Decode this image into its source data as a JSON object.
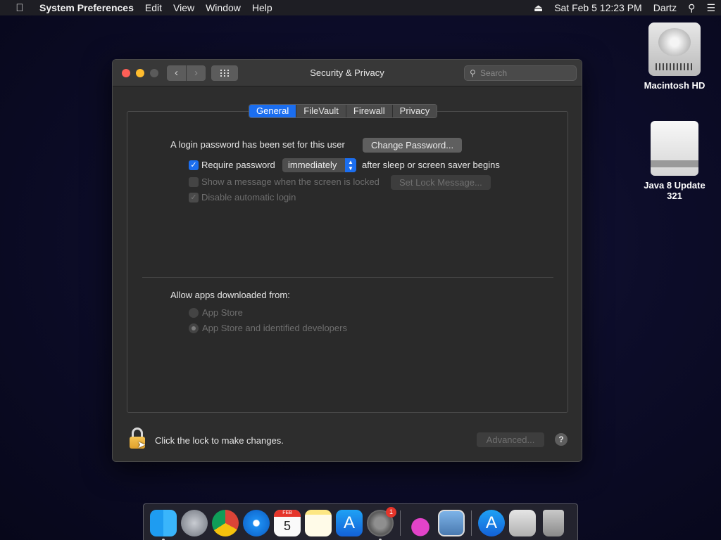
{
  "menubar": {
    "app_name": "System Preferences",
    "menus": [
      "Edit",
      "View",
      "Window",
      "Help"
    ],
    "datetime": "Sat Feb 5  12:23 PM",
    "user": "Dartz"
  },
  "desktop": {
    "icons": [
      {
        "label": "Macintosh HD"
      },
      {
        "label": "Java 8 Update 321"
      }
    ]
  },
  "window": {
    "title": "Security & Privacy",
    "search_placeholder": "Search",
    "tabs": [
      {
        "label": "General",
        "active": true
      },
      {
        "label": "FileVault",
        "active": false
      },
      {
        "label": "Firewall",
        "active": false
      },
      {
        "label": "Privacy",
        "active": false
      }
    ],
    "general": {
      "login_text": "A login password has been set for this user",
      "change_password_label": "Change Password...",
      "require_password_label": "Require password",
      "require_password_value": "immediately",
      "after_sleep_text": "after sleep or screen saver begins",
      "show_message_label": "Show a message when the screen is locked",
      "set_lock_message_label": "Set Lock Message...",
      "disable_autologin_label": "Disable automatic login",
      "allow_apps_heading": "Allow apps downloaded from:",
      "radio_app_store": "App Store",
      "radio_app_store_identified": "App Store and identified developers"
    },
    "footer": {
      "lock_text": "Click the lock to make changes.",
      "advanced_label": "Advanced...",
      "help_label": "?"
    }
  },
  "dock": {
    "calendar_month": "FEB",
    "calendar_day": "5",
    "prefs_badge": "1"
  },
  "colors": {
    "accent": "#1b6ef0",
    "window_bg": "#2d2d2d",
    "desktop_bg": "#0d0d2a"
  }
}
